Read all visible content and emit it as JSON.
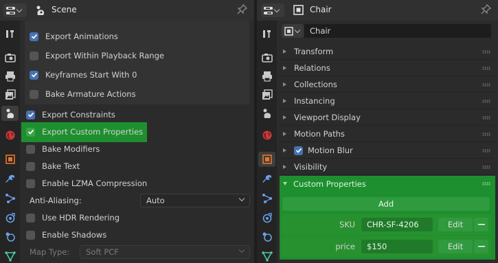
{
  "left_panel": {
    "header_title": "Scene",
    "subpanel_items": [
      {
        "label": "Export Animations",
        "checked": true
      },
      {
        "label": "Export Within Playback Range",
        "checked": false
      },
      {
        "label": "Keyframes Start With 0",
        "checked": true
      },
      {
        "label": "Bake Armature Actions",
        "checked": false
      }
    ],
    "items": [
      {
        "label": "Export Constraints",
        "checked": true
      },
      {
        "label": "Export Custom Properties",
        "checked": true,
        "highlighted": true
      },
      {
        "label": "Bake Modifiers",
        "checked": false
      },
      {
        "label": "Bake Text",
        "checked": false
      },
      {
        "label": "Enable LZMA Compression",
        "checked": false
      }
    ],
    "anti_aliasing": {
      "label": "Anti-Aliasing:",
      "value": "Auto"
    },
    "items2": [
      {
        "label": "Use HDR Rendering",
        "checked": false
      },
      {
        "label": "Enable Shadows",
        "checked": false
      }
    ],
    "map_type": {
      "label": "Map Type:",
      "value": "Soft PCF"
    }
  },
  "right_panel": {
    "header_title": "Chair",
    "object_name": "Chair",
    "sections": [
      "Transform",
      "Relations",
      "Collections",
      "Instancing",
      "Viewport Display",
      "Motion Paths"
    ],
    "motion_blur": {
      "label": "Motion Blur",
      "checked": true
    },
    "visibility": "Visibility",
    "custom_properties": {
      "title": "Custom Properties",
      "add_label": "Add",
      "properties": [
        {
          "name": "SKU",
          "value": "CHR-SF-4206",
          "edit_label": "Edit"
        },
        {
          "name": "price",
          "value": "$150",
          "edit_label": "Edit"
        }
      ]
    }
  },
  "colors": {
    "highlight": "#1e8f2f",
    "accent": "#4772b3",
    "background": "#2b2b2b"
  }
}
